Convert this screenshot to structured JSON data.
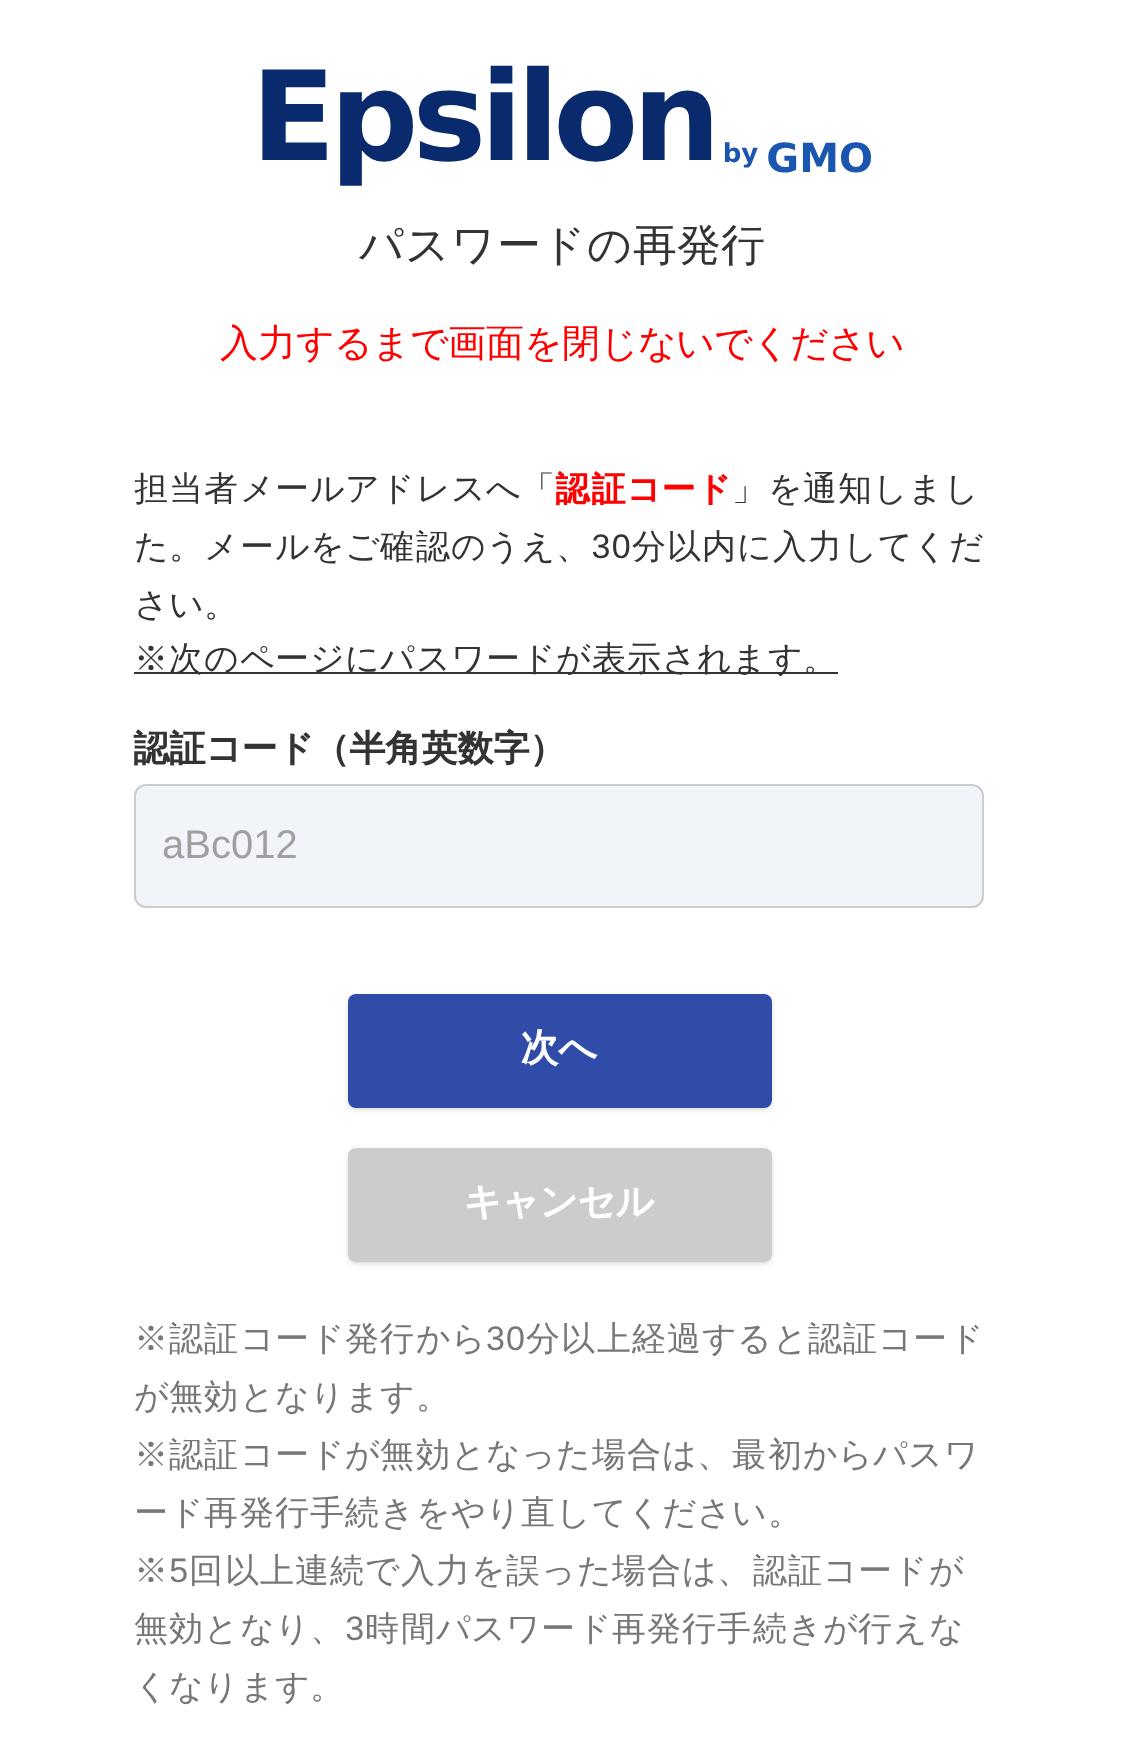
{
  "logo": {
    "wordmark": "Epsilon",
    "byline": "by",
    "brand": "GMO"
  },
  "title": "パスワードの再発行",
  "warning": "入力するまで画面を閉じないでください",
  "message": "担当者メールアドレスへ「**認証コード**」を通知しました。メールをご確認のうえ、30分以内に入力してください。",
  "notice_link": "※次のページにパスワードが表示されます。",
  "code_field": {
    "label": "認証コード（半角英数字）",
    "placeholder": "aBc012"
  },
  "buttons": [
    {
      "label": "次へ",
      "kind": "primary"
    },
    {
      "label": "キャンセル",
      "kind": "secondary"
    }
  ],
  "notes": [
    "※認証コード発行から30分以上経過すると認証コードが無効となります。",
    "※認証コードが無効となった場合は、最初からパスワード再発行手続きをやり直してください。",
    "※5回以上連続で入力を誤った場合は、認証コードが無効となり、3時間パスワード再発行手続きが行えなくなります。"
  ]
}
